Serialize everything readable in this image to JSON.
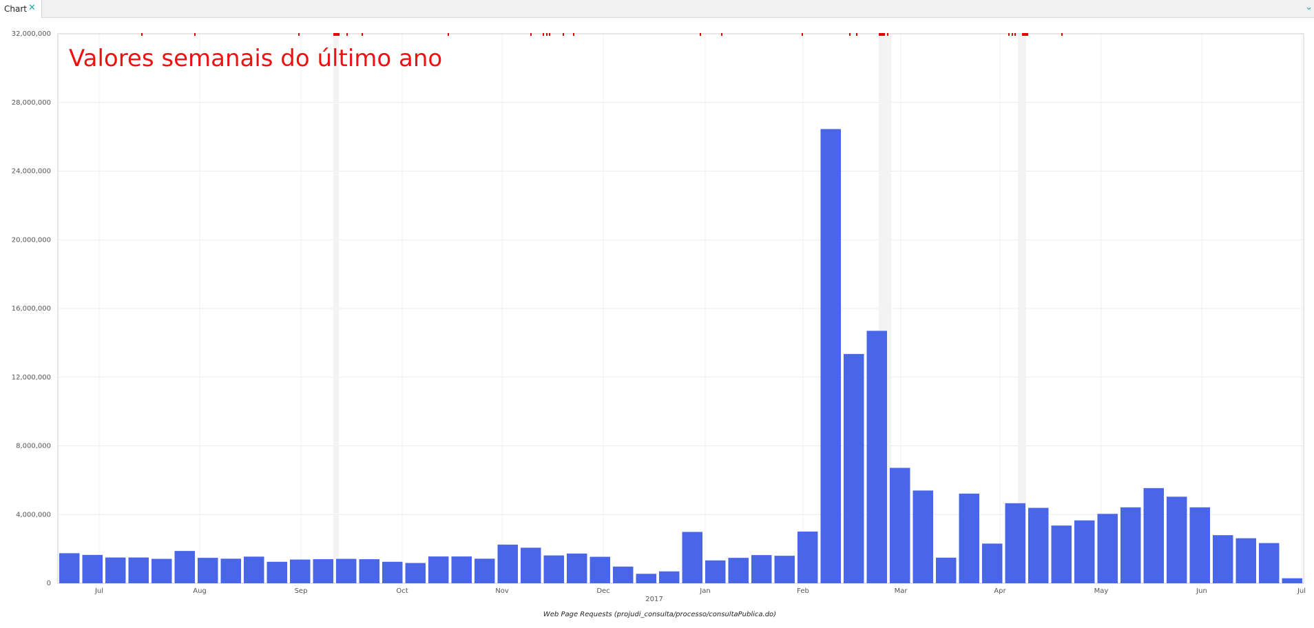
{
  "tab": {
    "label": "Chart",
    "close_icon": "close-icon",
    "dropdown_icon": "chevron-down-icon"
  },
  "colors": {
    "bar": "#4a66e8",
    "title": "#ee1111",
    "marker": "#dd0000",
    "accent": "#1aa7b8"
  },
  "chart_data": {
    "type": "bar",
    "title": "Valores semanais do último ano",
    "xlabel": "Web Page Requests (projudi_consulta/processo/consultaPublica.do)",
    "year_label": "2017",
    "ylim": [
      0,
      32000000
    ],
    "y_ticks": [
      0,
      4000000,
      8000000,
      12000000,
      16000000,
      20000000,
      24000000,
      28000000,
      32000000
    ],
    "y_tick_labels": [
      "0",
      "4,000,000",
      "8,000,000",
      "12,000,000",
      "16,000,000",
      "20,000,000",
      "24,000,000",
      "28,000,000",
      "32,000,000"
    ],
    "x_tick_labels": [
      "Jul",
      "Aug",
      "Sep",
      "Oct",
      "Nov",
      "Dec",
      "Jan",
      "Feb",
      "Mar",
      "Apr",
      "May",
      "Jun",
      "Jul"
    ],
    "grid": true,
    "values": [
      1750000,
      1650000,
      1500000,
      1500000,
      1420000,
      1880000,
      1480000,
      1430000,
      1550000,
      1250000,
      1380000,
      1400000,
      1420000,
      1400000,
      1250000,
      1180000,
      1560000,
      1560000,
      1430000,
      2250000,
      2070000,
      1620000,
      1730000,
      1540000,
      970000,
      550000,
      690000,
      2990000,
      1330000,
      1480000,
      1640000,
      1600000,
      3010000,
      26450000,
      13350000,
      14700000,
      6720000,
      5400000,
      1490000,
      5220000,
      2310000,
      4660000,
      4390000,
      3360000,
      3660000,
      4040000,
      4420000,
      5540000,
      5040000,
      4420000,
      2800000,
      2620000,
      2340000,
      290000
    ]
  }
}
